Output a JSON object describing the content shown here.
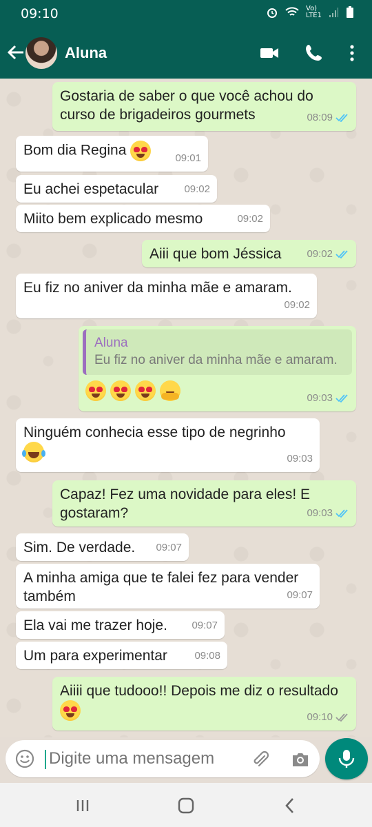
{
  "status_bar": {
    "time": "09:10",
    "network_label": "Vo) LTE1"
  },
  "header": {
    "contact_name": "Aluna"
  },
  "messages": [
    {
      "dir": "out",
      "text": "Gostaria de saber o que você achou do curso de brigadeiros gourmets",
      "time": "08:09",
      "status": "read"
    },
    {
      "dir": "in",
      "text": "Bom dia Regina",
      "emoji": "smiling-heart-eyes",
      "time": "09:01"
    },
    {
      "dir": "in",
      "text": "Eu achei espetacular",
      "time": "09:02"
    },
    {
      "dir": "in",
      "text": "Miito bem explicado mesmo",
      "time": "09:02"
    },
    {
      "dir": "out",
      "text": "Aiii que bom Jéssica",
      "time": "09:02",
      "status": "read"
    },
    {
      "dir": "in",
      "text": "Eu fiz no aniver da minha mãe e amaram.",
      "time": "09:02"
    },
    {
      "dir": "out",
      "quote": {
        "name": "Aluna",
        "text": "Eu fiz no aniver da minha mãe e amaram."
      },
      "emojis": [
        "heart-eyes",
        "heart-eyes",
        "heart-eyes",
        "hugging"
      ],
      "time": "09:03",
      "status": "read"
    },
    {
      "dir": "in",
      "text": "Ninguém conhecia esse tipo de negrinho",
      "emoji": "tears-of-joy",
      "time": "09:03"
    },
    {
      "dir": "out",
      "text": "Capaz! Fez uma novidade para eles! E gostaram?",
      "time": "09:03",
      "status": "read"
    },
    {
      "dir": "in",
      "text": "Sim. De verdade.",
      "time": "09:07"
    },
    {
      "dir": "in",
      "text": "A minha amiga que te falei fez para vender também",
      "time": "09:07"
    },
    {
      "dir": "in",
      "text": "Ela vai me trazer hoje.",
      "time": "09:07"
    },
    {
      "dir": "in",
      "text": "Um para experimentar",
      "time": "09:08"
    },
    {
      "dir": "out",
      "text": "Aiiii que tudooo!! Depois me diz o resultado",
      "emoji": "heart-eyes",
      "time": "09:10",
      "status": "delivered"
    }
  ],
  "composer": {
    "placeholder": "Digite uma mensagem"
  },
  "colors": {
    "header": "#075e54",
    "outgoing_bubble": "#dcf8c6",
    "incoming_bubble": "#ffffff",
    "read_tick": "#4fc3f7",
    "mic_button": "#00897b"
  }
}
